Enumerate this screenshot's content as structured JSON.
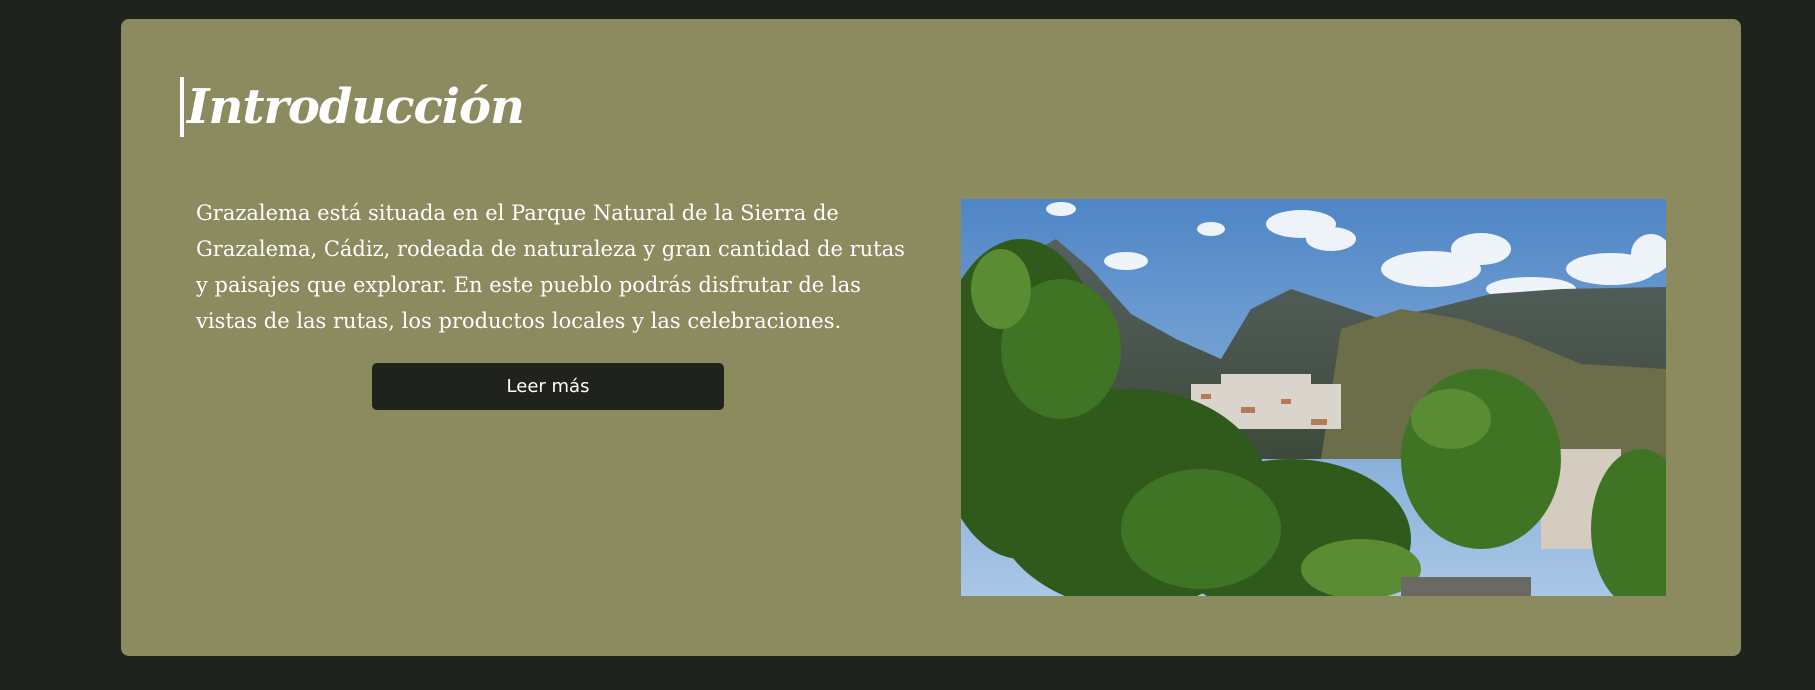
{
  "section": {
    "title": "Introducción",
    "paragraph": "Grazalema está situada en el Parque Natural de la Sierra de Grazalema, Cádiz, rodeada de naturaleza y gran cantidad de rutas y paisajes que explorar. En este pueblo podrás disfrutar de las vistas de las rutas, los productos locales y las celebraciones.",
    "button_label": "Leer más"
  },
  "colors": {
    "page_background": "#1f221d",
    "card_background": "#8c8a5f",
    "button_background": "#1f221d",
    "text": "#ffffff"
  },
  "image": {
    "subject": "Vista panorámica del pueblo blanco de Grazalema entre montañas y árboles"
  }
}
